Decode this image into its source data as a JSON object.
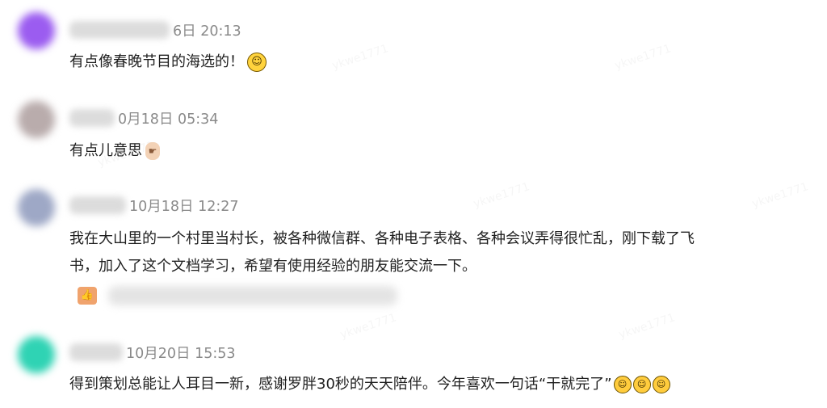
{
  "comments": [
    {
      "date_partial": "6日 20:13",
      "text": "有点像春晚节目的海选的！",
      "emoji_icons": [
        "grinning-face"
      ],
      "avatar_color": "#9b5cf0"
    },
    {
      "date_partial": "0月18日 05:34",
      "text": "有点儿意思",
      "emoji_icons": [
        "pointing-hand"
      ],
      "avatar_color": "#b9acac"
    },
    {
      "date_partial": "10月18日 12:27",
      "text_line1": "我在大山里的一个村里当村长，被各种微信群、各种电子表格、各种会议弄得很忙乱，刚下载了飞",
      "text_line2": "书，加入了这个文档学习，希望有使用经验的朋友能交流一下。",
      "reaction_icon": "thumbs-up",
      "avatar_color": "#9ea8c6"
    },
    {
      "date_partial": "10月20日 15:53",
      "text": "得到策划总能让人耳目一新，感谢罗胖30秒的天天陪伴。今年喜欢一句话“干就完了”",
      "emoji_icons": [
        "laughing-face",
        "laughing-face",
        "laughing-face"
      ],
      "avatar_color": "#2fd3b4"
    }
  ]
}
